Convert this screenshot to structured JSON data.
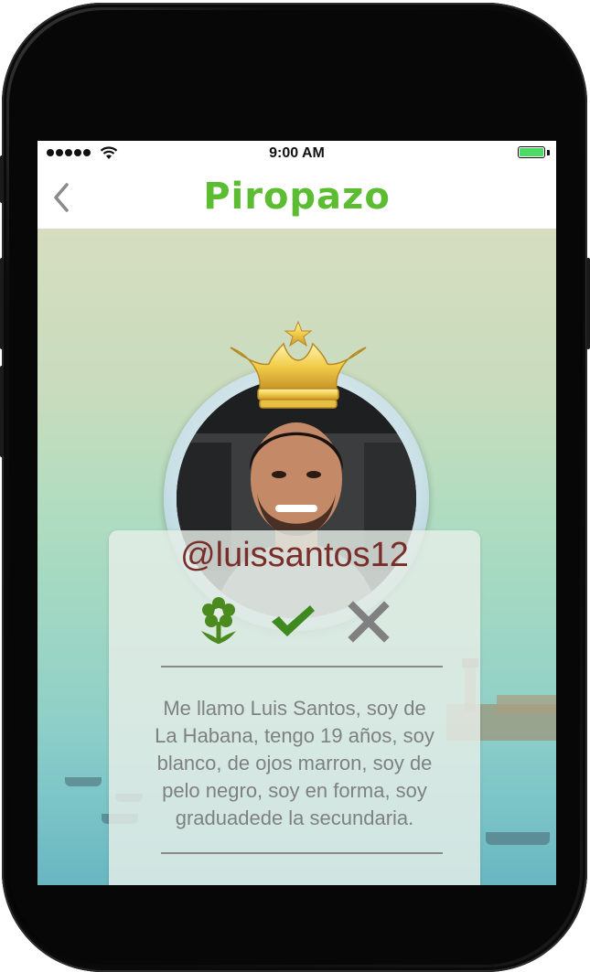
{
  "status_bar": {
    "time": "9:00 AM",
    "signal_icon": "cellular-signal-icon",
    "wifi_icon": "wifi-icon",
    "battery_icon": "battery-icon",
    "battery_level": 1.0,
    "battery_color": "#4cd964"
  },
  "navbar": {
    "back_icon": "chevron-left-icon",
    "logo_text": "Piropazo",
    "logo_color": "#5cbc32"
  },
  "profile": {
    "badge_icon": "crown-icon",
    "avatar": "profile-photo",
    "username": "@luissantos12",
    "username_color": "#7a2e2a",
    "actions": [
      {
        "icon": "flower-icon",
        "color": "#4a8a1e"
      },
      {
        "icon": "checkmark-icon",
        "color": "#3f8a1e"
      },
      {
        "icon": "close-icon",
        "color": "#808080"
      }
    ],
    "bio": "Me llamo Luis Santos, soy de\nLa Habana, tengo 19 años, soy\nblanco, de ojos marron, soy de\npelo negro, soy en forma, soy\ngraduadede la secundaria."
  }
}
